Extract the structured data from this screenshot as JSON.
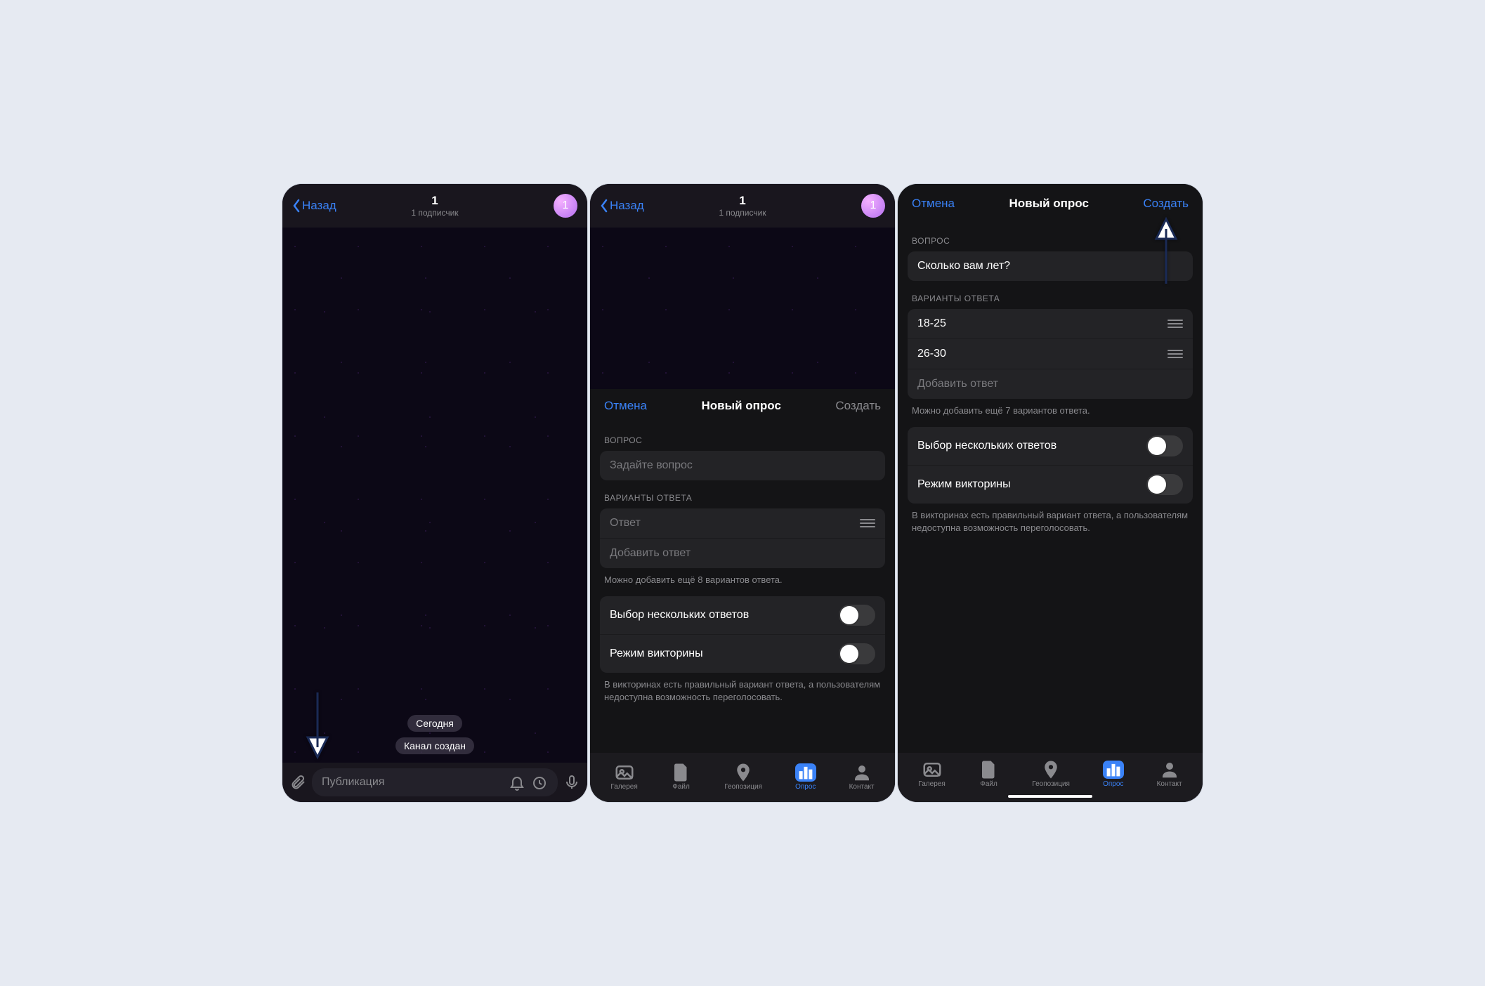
{
  "pane1": {
    "back": "Назад",
    "title": "1",
    "subtitle": "1 подписчик",
    "avatar": "1",
    "date_pill": "Сегодня",
    "created_pill": "Канал создан",
    "compose_placeholder": "Публикация"
  },
  "pane2": {
    "back": "Назад",
    "title": "1",
    "subtitle": "1 подписчик",
    "avatar": "1",
    "sheet": {
      "cancel": "Отмена",
      "heading": "Новый опрос",
      "create": "Создать",
      "question_label": "ВОПРОС",
      "question_placeholder": "Задайте вопрос",
      "answers_label": "ВАРИАНТЫ ОТВЕТА",
      "answer_placeholder": "Ответ",
      "add_answer": "Добавить ответ",
      "remaining": "Можно добавить ещё 8 вариантов ответа.",
      "multi": "Выбор нескольких ответов",
      "quiz": "Режим викторины",
      "quiz_note": "В викторинах есть правильный вариант ответа, а пользователям недоступна возможность переголосовать."
    },
    "tabs": {
      "gallery": "Галерея",
      "file": "Файл",
      "location": "Геопозиция",
      "poll": "Опрос",
      "contact": "Контакт"
    }
  },
  "pane3": {
    "sheet": {
      "cancel": "Отмена",
      "heading": "Новый опрос",
      "create": "Создать",
      "question_label": "ВОПРОС",
      "question_value": "Сколько вам лет?",
      "answers_label": "ВАРИАНТЫ ОТВЕТА",
      "answers": [
        "18-25",
        "26-30"
      ],
      "add_answer": "Добавить ответ",
      "remaining": "Можно добавить ещё 7 вариантов ответа.",
      "multi": "Выбор нескольких ответов",
      "quiz": "Режим викторины",
      "quiz_note": "В викторинах есть правильный вариант ответа, а пользователям недоступна возможность переголосовать."
    },
    "tabs": {
      "gallery": "Галерея",
      "file": "Файл",
      "location": "Геопозиция",
      "poll": "Опрос",
      "contact": "Контакт"
    }
  }
}
